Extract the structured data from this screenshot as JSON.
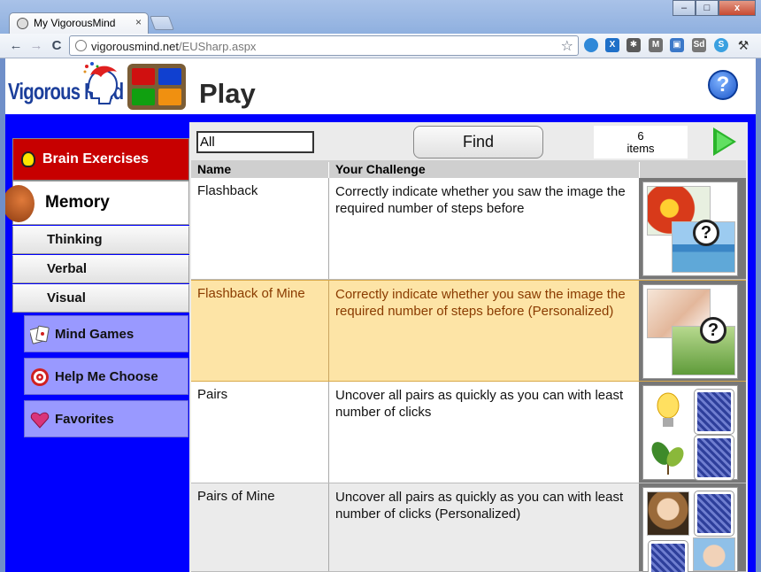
{
  "browser": {
    "tab_title": "My VigorousMind",
    "tab_close": "×",
    "url_host": "vigorousmind.net",
    "url_path": "/EUSharp.aspx",
    "win_minimize": "–",
    "win_maximize": "□",
    "win_close": "x",
    "back": "←",
    "forward": "→",
    "reload": "C",
    "bookmark_star": "☆"
  },
  "header": {
    "logo_text": "Vigorous Mind",
    "page_title": "Play",
    "help": "?"
  },
  "sidebar": {
    "category": "Brain Exercises",
    "active_item": "Memory",
    "sub_items": [
      "Thinking",
      "Verbal",
      "Visual"
    ],
    "big_items": [
      "Mind Games",
      "Help Me Choose",
      "Favorites"
    ]
  },
  "toolbar": {
    "filter_value": "All",
    "find_label": "Find",
    "count_number": "6",
    "count_label": "items"
  },
  "table": {
    "headers": [
      "Name",
      "Your Challenge"
    ],
    "rows": [
      {
        "name": "Flashback",
        "desc": "Correctly indicate whether you saw the image the required number of steps before"
      },
      {
        "name": "Flashback of Mine",
        "desc": "Correctly indicate whether you saw the image the required number of steps before (Personalized)"
      },
      {
        "name": "Pairs",
        "desc": "Uncover all pairs as quickly as you can with least number of clicks"
      },
      {
        "name": "Pairs of Mine",
        "desc": "Uncover all pairs as quickly as you can with least number of clicks (Personalized)"
      }
    ],
    "question_mark": "?"
  },
  "colors": {
    "frame_blue": "#0000ff",
    "category_red": "#c70000",
    "sidebar_lilac": "#9999ff",
    "selected_row": "#fde4a6",
    "selected_text": "#8a3b00"
  }
}
